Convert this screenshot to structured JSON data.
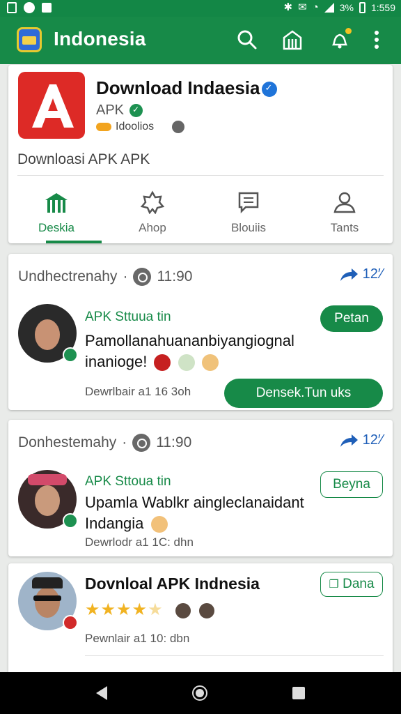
{
  "status_bar": {
    "battery": "3%",
    "time": "1:559"
  },
  "app_bar": {
    "title": "Indonesia",
    "icons": [
      "search-icon",
      "building-icon",
      "notification-icon",
      "more-vert-icon"
    ]
  },
  "app_card": {
    "name": "Download Indaesia",
    "sub": "APK",
    "meta": "Idoolios",
    "description": "Downloasi APK APK",
    "tabs": [
      {
        "label": "Deskia",
        "icon": "mosque-icon",
        "active": true
      },
      {
        "label": "Ahop",
        "icon": "star-badge-icon",
        "active": false
      },
      {
        "label": "Blouiis",
        "icon": "chat-icon",
        "active": false
      },
      {
        "label": "Tants",
        "icon": "person-icon",
        "active": false
      }
    ]
  },
  "posts": [
    {
      "header": "Undhectrenahy",
      "time": "11:90",
      "share": "12′⁄",
      "source": "APK Sttuua tin",
      "text": "Pamollanahuananbiyangiognal inanioge!",
      "footer": "Dewrlbair a1 16 3oh",
      "action": "Petan",
      "cta": "Densek.Tun uks"
    },
    {
      "header": "Donhestemahy",
      "time": "11:90",
      "share": "12′⁄",
      "source": "APK Sttoua tin",
      "text": "Upamla Wablkr aingleclanaidant Indangia",
      "footer": "Dewrlodr a1 1C: dhn",
      "action": "Beyna"
    },
    {
      "title": "Dovnloal APK Indnesia",
      "rating": 4,
      "footer": "Pewnlair a1 10: dbn",
      "action": "Dana"
    }
  ],
  "colors": {
    "primary": "#178a48",
    "accent_blue": "#1f5fb8",
    "star": "#f1b322"
  }
}
